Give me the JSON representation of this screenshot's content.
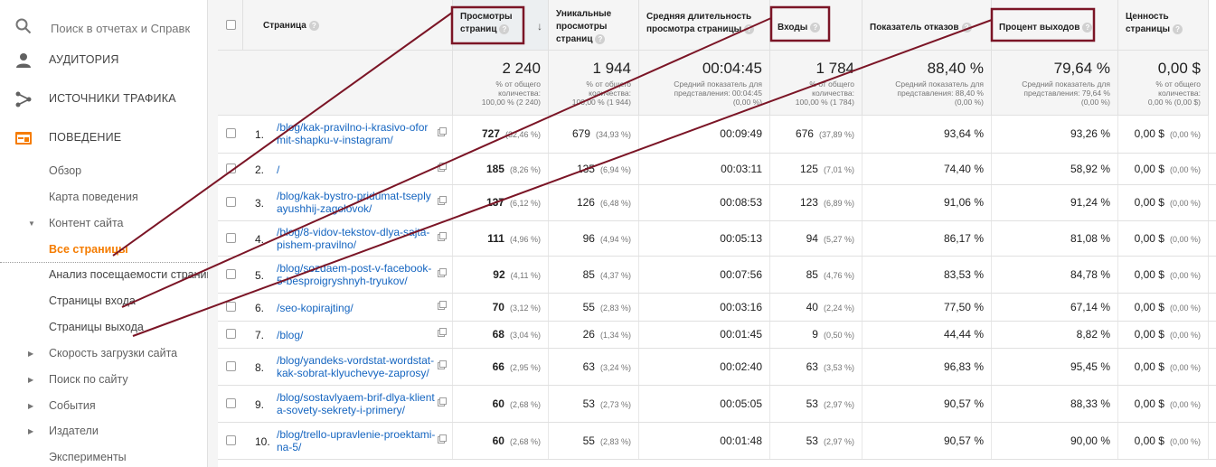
{
  "sidebar": {
    "search_placeholder": "Поиск в отчетах и Справк",
    "sections": [
      {
        "label": "АУДИТОРИЯ"
      },
      {
        "label": "ИСТОЧНИКИ ТРАФИКА"
      },
      {
        "label": "ПОВЕДЕНИЕ"
      }
    ],
    "items": [
      {
        "label": "Обзор"
      },
      {
        "label": "Карта поведения"
      },
      {
        "label": "Контент сайта"
      },
      {
        "label": "Все страницы"
      },
      {
        "label": "Анализ посещаемости страниц"
      },
      {
        "label": "Страницы входа"
      },
      {
        "label": "Страницы выхода"
      },
      {
        "label": "Скорость загрузки сайта"
      },
      {
        "label": "Поиск по сайту"
      },
      {
        "label": "События"
      },
      {
        "label": "Издатели"
      },
      {
        "label": "Эксперименты"
      }
    ]
  },
  "columns": {
    "page": "Страница",
    "pageviews": [
      "Просмотры",
      "страниц"
    ],
    "unique": [
      "Уникальные",
      "просмотры",
      "страниц"
    ],
    "avg_time": [
      "Средняя длительность",
      "просмотра страницы"
    ],
    "entrances": "Входы",
    "bounce": "Показатель отказов",
    "exit": "Процент выходов",
    "value": [
      "Ценность",
      "страницы"
    ]
  },
  "totals": {
    "pageviews": {
      "big": "2 240",
      "small": [
        "% от общего",
        "количества:",
        "100,00 % (2 240)"
      ]
    },
    "unique": {
      "big": "1 944",
      "small": [
        "% от общего",
        "количества:",
        "100,00 % (1 944)"
      ]
    },
    "avg_time": {
      "big": "00:04:45",
      "small": [
        "Средний показатель для",
        "представления: 00:04:45",
        "(0,00 %)"
      ]
    },
    "entrances": {
      "big": "1 784",
      "small": [
        "% от общего",
        "количества:",
        "100,00 % (1 784)"
      ]
    },
    "bounce": {
      "big": "88,40 %",
      "small": [
        "Средний показатель для",
        "представления: 88,40 %",
        "(0,00 %)"
      ]
    },
    "exit": {
      "big": "79,64 %",
      "small": [
        "Средний показатель для",
        "представления: 79,64 %",
        "(0,00 %)"
      ]
    },
    "value": {
      "big": "0,00 $",
      "small": [
        "% от общего",
        "количества:",
        "0,00 % (0,00 $)"
      ]
    }
  },
  "rows": [
    {
      "idx": "1.",
      "page": "/blog/kak-pravilno-i-krasivo-oformit-shapku-v-instagram/",
      "pv": "727",
      "pv_pct": "(32,46 %)",
      "upv": "679",
      "upv_pct": "(34,93 %)",
      "time": "00:09:49",
      "ent": "676",
      "ent_pct": "(37,89 %)",
      "bounce": "93,64 %",
      "exit": "93,26 %",
      "val": "0,00 $",
      "val_pct": "(0,00 %)"
    },
    {
      "idx": "2.",
      "page": "/",
      "pv": "185",
      "pv_pct": "(8,26 %)",
      "upv": "135",
      "upv_pct": "(6,94 %)",
      "time": "00:03:11",
      "ent": "125",
      "ent_pct": "(7,01 %)",
      "bounce": "74,40 %",
      "exit": "58,92 %",
      "val": "0,00 $",
      "val_pct": "(0,00 %)"
    },
    {
      "idx": "3.",
      "page": "/blog/kak-bystro-pridumat-tseplyayushhij-zagolovok/",
      "pv": "137",
      "pv_pct": "(6,12 %)",
      "upv": "126",
      "upv_pct": "(6,48 %)",
      "time": "00:08:53",
      "ent": "123",
      "ent_pct": "(6,89 %)",
      "bounce": "91,06 %",
      "exit": "91,24 %",
      "val": "0,00 $",
      "val_pct": "(0,00 %)"
    },
    {
      "idx": "4.",
      "page": "/blog/8-vidov-tekstov-dlya-sajta-pishem-pravilno/",
      "pv": "111",
      "pv_pct": "(4,96 %)",
      "upv": "96",
      "upv_pct": "(4,94 %)",
      "time": "00:05:13",
      "ent": "94",
      "ent_pct": "(5,27 %)",
      "bounce": "86,17 %",
      "exit": "81,08 %",
      "val": "0,00 $",
      "val_pct": "(0,00 %)"
    },
    {
      "idx": "5.",
      "page": "/blog/sozdaem-post-v-facebook-5-besproigryshnyh-tryukov/",
      "pv": "92",
      "pv_pct": "(4,11 %)",
      "upv": "85",
      "upv_pct": "(4,37 %)",
      "time": "00:07:56",
      "ent": "85",
      "ent_pct": "(4,76 %)",
      "bounce": "83,53 %",
      "exit": "84,78 %",
      "val": "0,00 $",
      "val_pct": "(0,00 %)"
    },
    {
      "idx": "6.",
      "page": "/seo-kopirajting/",
      "pv": "70",
      "pv_pct": "(3,12 %)",
      "upv": "55",
      "upv_pct": "(2,83 %)",
      "time": "00:03:16",
      "ent": "40",
      "ent_pct": "(2,24 %)",
      "bounce": "77,50 %",
      "exit": "67,14 %",
      "val": "0,00 $",
      "val_pct": "(0,00 %)"
    },
    {
      "idx": "7.",
      "page": "/blog/",
      "pv": "68",
      "pv_pct": "(3,04 %)",
      "upv": "26",
      "upv_pct": "(1,34 %)",
      "time": "00:01:45",
      "ent": "9",
      "ent_pct": "(0,50 %)",
      "bounce": "44,44 %",
      "exit": "8,82 %",
      "val": "0,00 $",
      "val_pct": "(0,00 %)"
    },
    {
      "idx": "8.",
      "page": "/blog/yandeks-vordstat-wordstat-kak-sobrat-klyuchevye-zaprosy/",
      "pv": "66",
      "pv_pct": "(2,95 %)",
      "upv": "63",
      "upv_pct": "(3,24 %)",
      "time": "00:02:40",
      "ent": "63",
      "ent_pct": "(3,53 %)",
      "bounce": "96,83 %",
      "exit": "95,45 %",
      "val": "0,00 $",
      "val_pct": "(0,00 %)"
    },
    {
      "idx": "9.",
      "page": "/blog/sostavlyaem-brif-dlya-klienta-sovety-sekrety-i-primery/",
      "pv": "60",
      "pv_pct": "(2,68 %)",
      "upv": "53",
      "upv_pct": "(2,73 %)",
      "time": "00:05:05",
      "ent": "53",
      "ent_pct": "(2,97 %)",
      "bounce": "90,57 %",
      "exit": "88,33 %",
      "val": "0,00 $",
      "val_pct": "(0,00 %)"
    },
    {
      "idx": "10.",
      "page": "/blog/trello-upravlenie-proektami-na-5/",
      "pv": "60",
      "pv_pct": "(2,68 %)",
      "upv": "55",
      "upv_pct": "(2,83 %)",
      "time": "00:01:48",
      "ent": "53",
      "ent_pct": "(2,97 %)",
      "bounce": "90,57 %",
      "exit": "90,00 %",
      "val": "0,00 $",
      "val_pct": "(0,00 %)"
    }
  ],
  "colors": {
    "annotation": "#7b1526",
    "active_nav": "#f57c00",
    "link": "#1565c0",
    "behavior_icon": "#f57c00"
  }
}
